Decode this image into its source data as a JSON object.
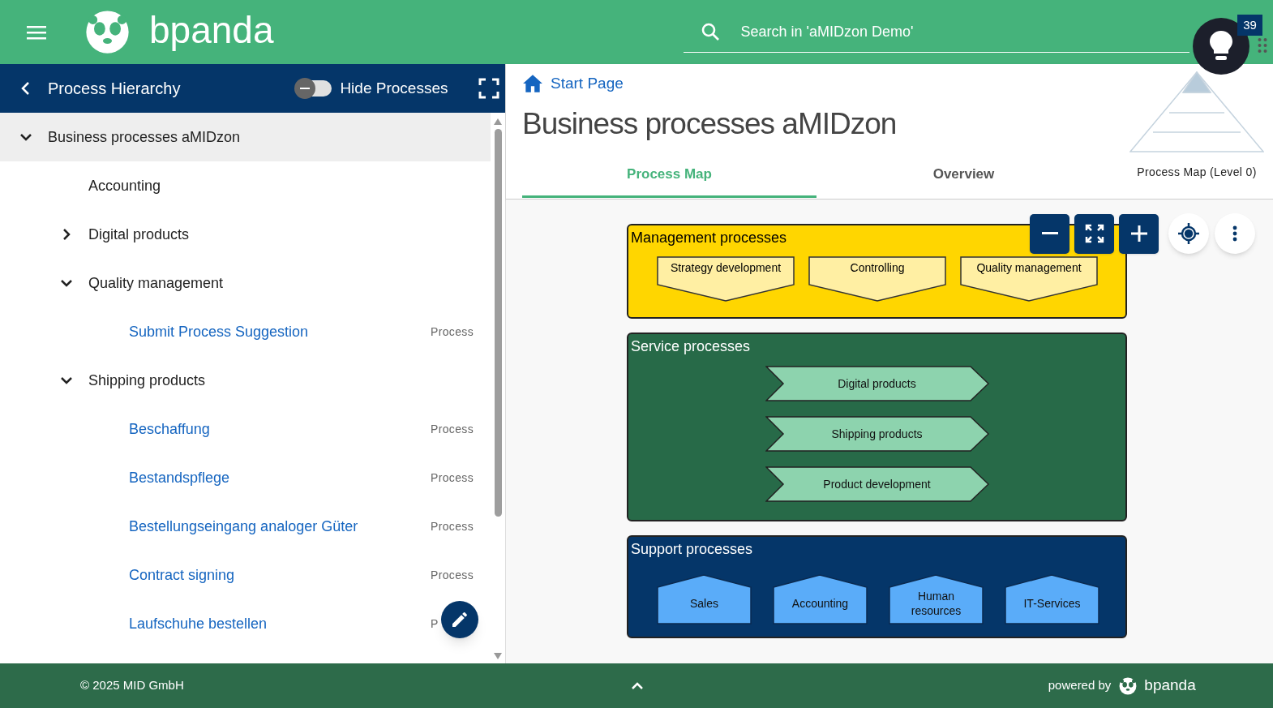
{
  "header": {
    "logo": "bpanda",
    "search": {
      "placeholder": "Search in 'aMIDzon Demo'"
    },
    "badge": "39"
  },
  "sidebar": {
    "title": "Process Hierarchy",
    "toggle": {
      "label": "Hide Processes",
      "on": false
    },
    "tree": [
      {
        "label": "Business processes aMIDzon",
        "kind": "group",
        "expanded": true,
        "selected": true,
        "children": [
          {
            "label": "Accounting",
            "kind": "group",
            "selected": false
          },
          {
            "label": "Digital products",
            "kind": "group",
            "expanded": false,
            "selected": false
          },
          {
            "label": "Quality management",
            "kind": "group",
            "expanded": true,
            "selected": false,
            "children": [
              {
                "label": "Submit Process Suggestion",
                "kind": "process",
                "type": "Process",
                "selected": false
              }
            ]
          },
          {
            "label": "Shipping products",
            "kind": "group",
            "expanded": true,
            "selected": false,
            "children": [
              {
                "label": "Beschaffung",
                "kind": "process",
                "type": "Process",
                "selected": false
              },
              {
                "label": "Bestandspflege",
                "kind": "process",
                "type": "Process",
                "selected": false
              },
              {
                "label": "Bestellungseingang analoger Güter",
                "kind": "process",
                "type": "Process",
                "selected": false
              },
              {
                "label": "Contract signing",
                "kind": "process",
                "type": "Process",
                "selected": false
              },
              {
                "label": "Laufschuhe bestellen",
                "kind": "process",
                "type": "P",
                "selected": false
              }
            ]
          }
        ]
      }
    ]
  },
  "breadcrumb": "Start Page",
  "title": "Business processes aMIDzon",
  "tabs": [
    {
      "label": "Process Map",
      "selected": true
    },
    {
      "label": "Overview",
      "selected": false
    }
  ],
  "level_label": "Process Map (Level 0)",
  "diagram": {
    "groups": [
      {
        "title": "Management processes",
        "kind": "management",
        "processes": [
          "Strategy development",
          "Controlling",
          "Quality management"
        ]
      },
      {
        "title": "Service processes",
        "kind": "service",
        "processes": [
          "Digital products",
          "Shipping products",
          "Product development"
        ]
      },
      {
        "title": "Support processes",
        "kind": "support",
        "processes": [
          "Sales",
          "Accounting",
          "Human resources",
          "IT-Services"
        ]
      }
    ]
  },
  "footer": {
    "copyright": "© 2025 MID GmbH",
    "powered_by": "powered by",
    "brand": "bpanda"
  }
}
